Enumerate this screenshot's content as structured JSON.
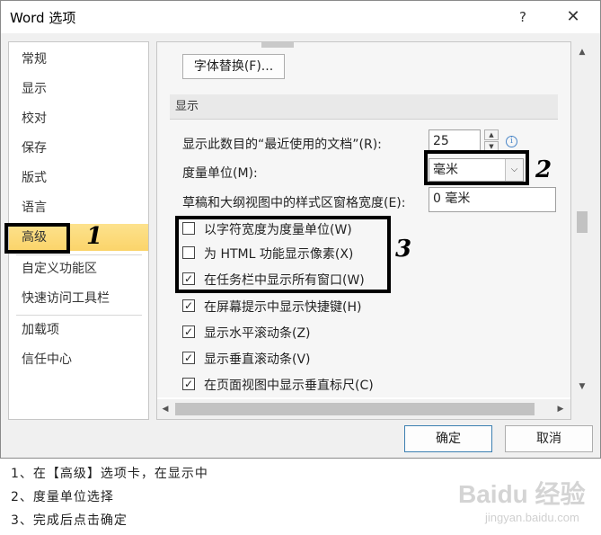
{
  "window": {
    "title": "Word 选项",
    "help_label": "?",
    "close_label": "✕"
  },
  "sidebar": {
    "items": [
      {
        "label": "常规"
      },
      {
        "label": "显示"
      },
      {
        "label": "校对"
      },
      {
        "label": "保存"
      },
      {
        "label": "版式"
      },
      {
        "label": "语言"
      },
      {
        "label": "高级",
        "selected": true
      },
      {
        "label": "自定义功能区"
      },
      {
        "label": "快速访问工具栏"
      },
      {
        "label": "加载项"
      },
      {
        "label": "信任中心"
      }
    ]
  },
  "content": {
    "font_substitution_button": "字体替换(F)...",
    "display_section_title": "显示",
    "recent_docs_label": "显示此数目的“最近使用的文档”(R):",
    "recent_docs_value": "25",
    "measurement_units_label": "度量单位(M):",
    "measurement_units_value": "毫米",
    "style_area_label": "草稿和大纲视图中的样式区窗格宽度(E):",
    "style_area_value": "0 毫米",
    "options": [
      {
        "label": "以字符宽度为度量单位(W)",
        "checked": false
      },
      {
        "label": "为 HTML 功能显示像素(X)",
        "checked": false
      },
      {
        "label": "在任务栏中显示所有窗口(W)",
        "checked": true
      },
      {
        "label": "在屏幕提示中显示快捷键(H)",
        "checked": true
      },
      {
        "label": "显示水平滚动条(Z)",
        "checked": true
      },
      {
        "label": "显示垂直滚动条(V)",
        "checked": true
      },
      {
        "label": "在页面视图中显示垂直标尺(C)",
        "checked": true
      }
    ]
  },
  "footer": {
    "ok_label": "确定",
    "cancel_label": "取消"
  },
  "annotations": {
    "num1": "1",
    "num2": "2",
    "num3": "3"
  },
  "instructions": [
    "1、在【高级】选项卡，在显示中",
    "2、度量单位选择",
    "3、完成后点击确定"
  ],
  "watermark": {
    "main": "Baidu 经验",
    "sub": "jingyan.baidu.com"
  },
  "colors": {
    "selected_nav": "#fbd46a",
    "annotation": "#000000",
    "info_icon": "#4a86c8"
  }
}
